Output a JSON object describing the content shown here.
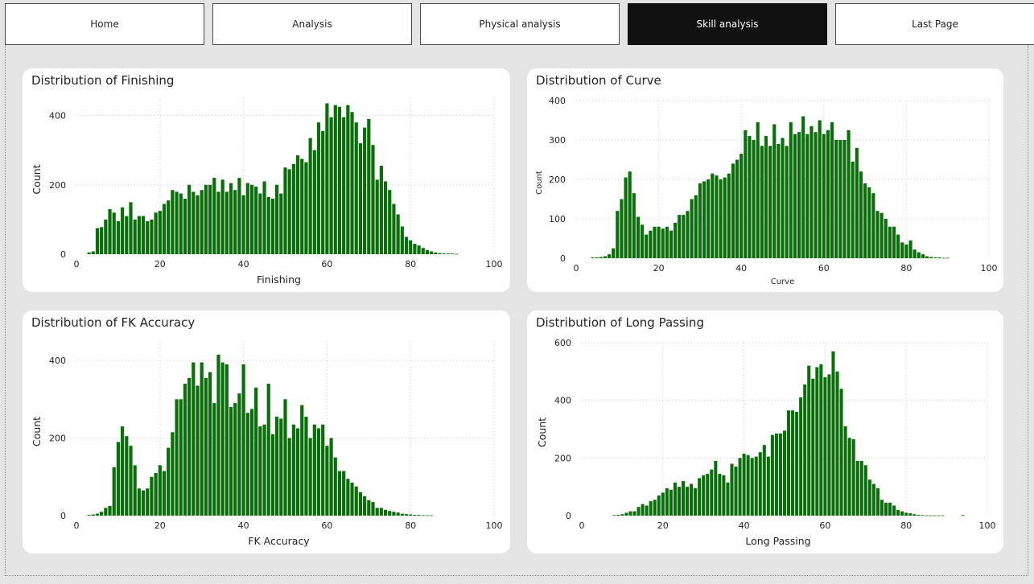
{
  "nav": {
    "items": [
      {
        "label": "Home",
        "active": false
      },
      {
        "label": "Analysis",
        "active": false
      },
      {
        "label": "Physical analysis",
        "active": false
      },
      {
        "label": "Skill analysis",
        "active": true
      },
      {
        "label": "Last Page",
        "active": false
      }
    ]
  },
  "colors": {
    "bar": "#0a6e0a",
    "page_background": "#e4e4e4",
    "card_background": "#ffffff",
    "active_tab": "#111111"
  },
  "chart_data": [
    {
      "type": "bar",
      "title": "Distribution of Finishing",
      "xlabel": "Finishing",
      "ylabel": "Count",
      "xlim": [
        0,
        100
      ],
      "ylim": [
        0,
        450
      ],
      "xticks": [
        0,
        20,
        40,
        60,
        80,
        100
      ],
      "yticks": [
        0,
        200,
        400
      ],
      "grid": true,
      "x": [
        2,
        3,
        4,
        5,
        6,
        7,
        8,
        9,
        10,
        11,
        12,
        13,
        14,
        15,
        16,
        17,
        18,
        19,
        20,
        21,
        22,
        23,
        24,
        25,
        26,
        27,
        28,
        29,
        30,
        31,
        32,
        33,
        34,
        35,
        36,
        37,
        38,
        39,
        40,
        41,
        42,
        43,
        44,
        45,
        46,
        47,
        48,
        49,
        50,
        51,
        52,
        53,
        54,
        55,
        56,
        57,
        58,
        59,
        60,
        61,
        62,
        63,
        64,
        65,
        66,
        67,
        68,
        69,
        70,
        71,
        72,
        73,
        74,
        75,
        76,
        77,
        78,
        79,
        80,
        81,
        82,
        83,
        84,
        85,
        86,
        87,
        88,
        89,
        90,
        91,
        92,
        93,
        94,
        95
      ],
      "values": [
        0,
        5,
        8,
        75,
        78,
        100,
        130,
        120,
        95,
        135,
        110,
        150,
        100,
        110,
        110,
        95,
        100,
        120,
        125,
        145,
        155,
        185,
        180,
        175,
        160,
        200,
        180,
        170,
        185,
        200,
        200,
        220,
        180,
        215,
        180,
        205,
        185,
        220,
        170,
        205,
        200,
        195,
        175,
        210,
        165,
        160,
        200,
        175,
        250,
        245,
        260,
        285,
        275,
        265,
        335,
        300,
        380,
        355,
        435,
        395,
        430,
        425,
        395,
        430,
        410,
        380,
        320,
        365,
        390,
        315,
        215,
        255,
        210,
        185,
        145,
        115,
        80,
        50,
        40,
        30,
        25,
        18,
        12,
        8,
        5,
        3,
        2,
        2,
        2,
        1
      ]
    },
    {
      "type": "bar",
      "title": "Distribution of Curve",
      "xlabel": "Curve",
      "ylabel": "Count",
      "xlim": [
        0,
        100
      ],
      "ylim": [
        0,
        400
      ],
      "xticks": [
        0,
        20,
        40,
        60,
        80,
        100
      ],
      "yticks": [
        0,
        100,
        200,
        300,
        400
      ],
      "grid": true,
      "x": [
        2,
        3,
        4,
        5,
        6,
        7,
        8,
        9,
        10,
        11,
        12,
        13,
        14,
        15,
        16,
        17,
        18,
        19,
        20,
        21,
        22,
        23,
        24,
        25,
        26,
        27,
        28,
        29,
        30,
        31,
        32,
        33,
        34,
        35,
        36,
        37,
        38,
        39,
        40,
        41,
        42,
        43,
        44,
        45,
        46,
        47,
        48,
        49,
        50,
        51,
        52,
        53,
        54,
        55,
        56,
        57,
        58,
        59,
        60,
        61,
        62,
        63,
        64,
        65,
        66,
        67,
        68,
        69,
        70,
        71,
        72,
        73,
        74,
        75,
        76,
        77,
        78,
        79,
        80,
        81,
        82,
        83,
        84,
        85,
        86,
        87,
        88,
        89,
        90,
        91,
        92,
        93,
        94,
        95
      ],
      "values": [
        0,
        0,
        2,
        2,
        3,
        5,
        10,
        25,
        120,
        150,
        205,
        220,
        165,
        105,
        85,
        60,
        70,
        80,
        80,
        75,
        80,
        70,
        90,
        110,
        110,
        120,
        150,
        160,
        190,
        195,
        200,
        215,
        210,
        200,
        205,
        215,
        240,
        250,
        265,
        325,
        310,
        300,
        345,
        285,
        310,
        285,
        340,
        290,
        305,
        285,
        345,
        315,
        320,
        360,
        315,
        335,
        320,
        350,
        315,
        325,
        345,
        300,
        300,
        300,
        325,
        245,
        280,
        220,
        190,
        180,
        165,
        120,
        115,
        100,
        80,
        80,
        60,
        40,
        35,
        45,
        22,
        15,
        10,
        5,
        3,
        2,
        2,
        1,
        1,
        0,
        0,
        0,
        0,
        0
      ]
    },
    {
      "type": "bar",
      "title": "Distribution of FK Accuracy",
      "xlabel": "FK Accuracy",
      "ylabel": "Count",
      "xlim": [
        0,
        100
      ],
      "ylim": [
        0,
        450
      ],
      "xticks": [
        0,
        20,
        40,
        60,
        80,
        100
      ],
      "yticks": [
        0,
        200,
        400
      ],
      "grid": true,
      "x": [
        2,
        3,
        4,
        5,
        6,
        7,
        8,
        9,
        10,
        11,
        12,
        13,
        14,
        15,
        16,
        17,
        18,
        19,
        20,
        21,
        22,
        23,
        24,
        25,
        26,
        27,
        28,
        29,
        30,
        31,
        32,
        33,
        34,
        35,
        36,
        37,
        38,
        39,
        40,
        41,
        42,
        43,
        44,
        45,
        46,
        47,
        48,
        49,
        50,
        51,
        52,
        53,
        54,
        55,
        56,
        57,
        58,
        59,
        60,
        61,
        62,
        63,
        64,
        65,
        66,
        67,
        68,
        69,
        70,
        71,
        72,
        73,
        74,
        75,
        76,
        77,
        78,
        79,
        80,
        81,
        82,
        83,
        84,
        85,
        86,
        87,
        88,
        89,
        90,
        91,
        92,
        93,
        94,
        95
      ],
      "values": [
        0,
        2,
        3,
        5,
        10,
        20,
        25,
        125,
        190,
        230,
        205,
        180,
        130,
        70,
        65,
        70,
        100,
        110,
        130,
        115,
        175,
        215,
        300,
        300,
        340,
        355,
        395,
        335,
        395,
        355,
        370,
        290,
        415,
        395,
        390,
        280,
        290,
        315,
        390,
        265,
        275,
        330,
        230,
        235,
        340,
        210,
        255,
        250,
        300,
        200,
        235,
        225,
        285,
        255,
        200,
        235,
        225,
        235,
        180,
        200,
        150,
        115,
        115,
        95,
        85,
        75,
        60,
        50,
        40,
        35,
        20,
        20,
        15,
        12,
        10,
        8,
        5,
        4,
        3,
        2,
        2,
        1,
        1,
        1,
        0,
        0,
        0,
        0,
        0,
        0,
        0,
        0,
        0,
        0
      ]
    },
    {
      "type": "bar",
      "title": "Distribution of Long Passing",
      "xlabel": "Long Passing",
      "ylabel": "Count",
      "xlim": [
        0,
        100
      ],
      "ylim": [
        0,
        600
      ],
      "xticks": [
        0,
        20,
        40,
        60,
        80,
        100
      ],
      "yticks": [
        0,
        200,
        400,
        600
      ],
      "grid": true,
      "x": [
        8,
        9,
        10,
        11,
        12,
        13,
        14,
        15,
        16,
        17,
        18,
        19,
        20,
        21,
        22,
        23,
        24,
        25,
        26,
        27,
        28,
        29,
        30,
        31,
        32,
        33,
        34,
        35,
        36,
        37,
        38,
        39,
        40,
        41,
        42,
        43,
        44,
        45,
        46,
        47,
        48,
        49,
        50,
        51,
        52,
        53,
        54,
        55,
        56,
        57,
        58,
        59,
        60,
        61,
        62,
        63,
        64,
        65,
        66,
        67,
        68,
        69,
        70,
        71,
        72,
        73,
        74,
        75,
        76,
        77,
        78,
        79,
        80,
        81,
        82,
        83,
        84,
        85,
        86,
        87,
        88,
        89,
        90,
        91,
        92,
        93,
        94
      ],
      "values": [
        2,
        3,
        5,
        10,
        15,
        15,
        30,
        40,
        35,
        50,
        55,
        70,
        80,
        95,
        90,
        115,
        100,
        120,
        100,
        110,
        95,
        130,
        140,
        145,
        160,
        190,
        145,
        140,
        115,
        180,
        170,
        200,
        215,
        210,
        200,
        205,
        220,
        245,
        205,
        280,
        285,
        285,
        295,
        365,
        365,
        360,
        410,
        455,
        520,
        475,
        515,
        525,
        480,
        490,
        570,
        500,
        440,
        310,
        270,
        265,
        190,
        190,
        175,
        125,
        110,
        95,
        55,
        45,
        45,
        35,
        20,
        15,
        10,
        8,
        5,
        3,
        2,
        1,
        1,
        1,
        1,
        1,
        0,
        0,
        0,
        0,
        2
      ]
    }
  ]
}
